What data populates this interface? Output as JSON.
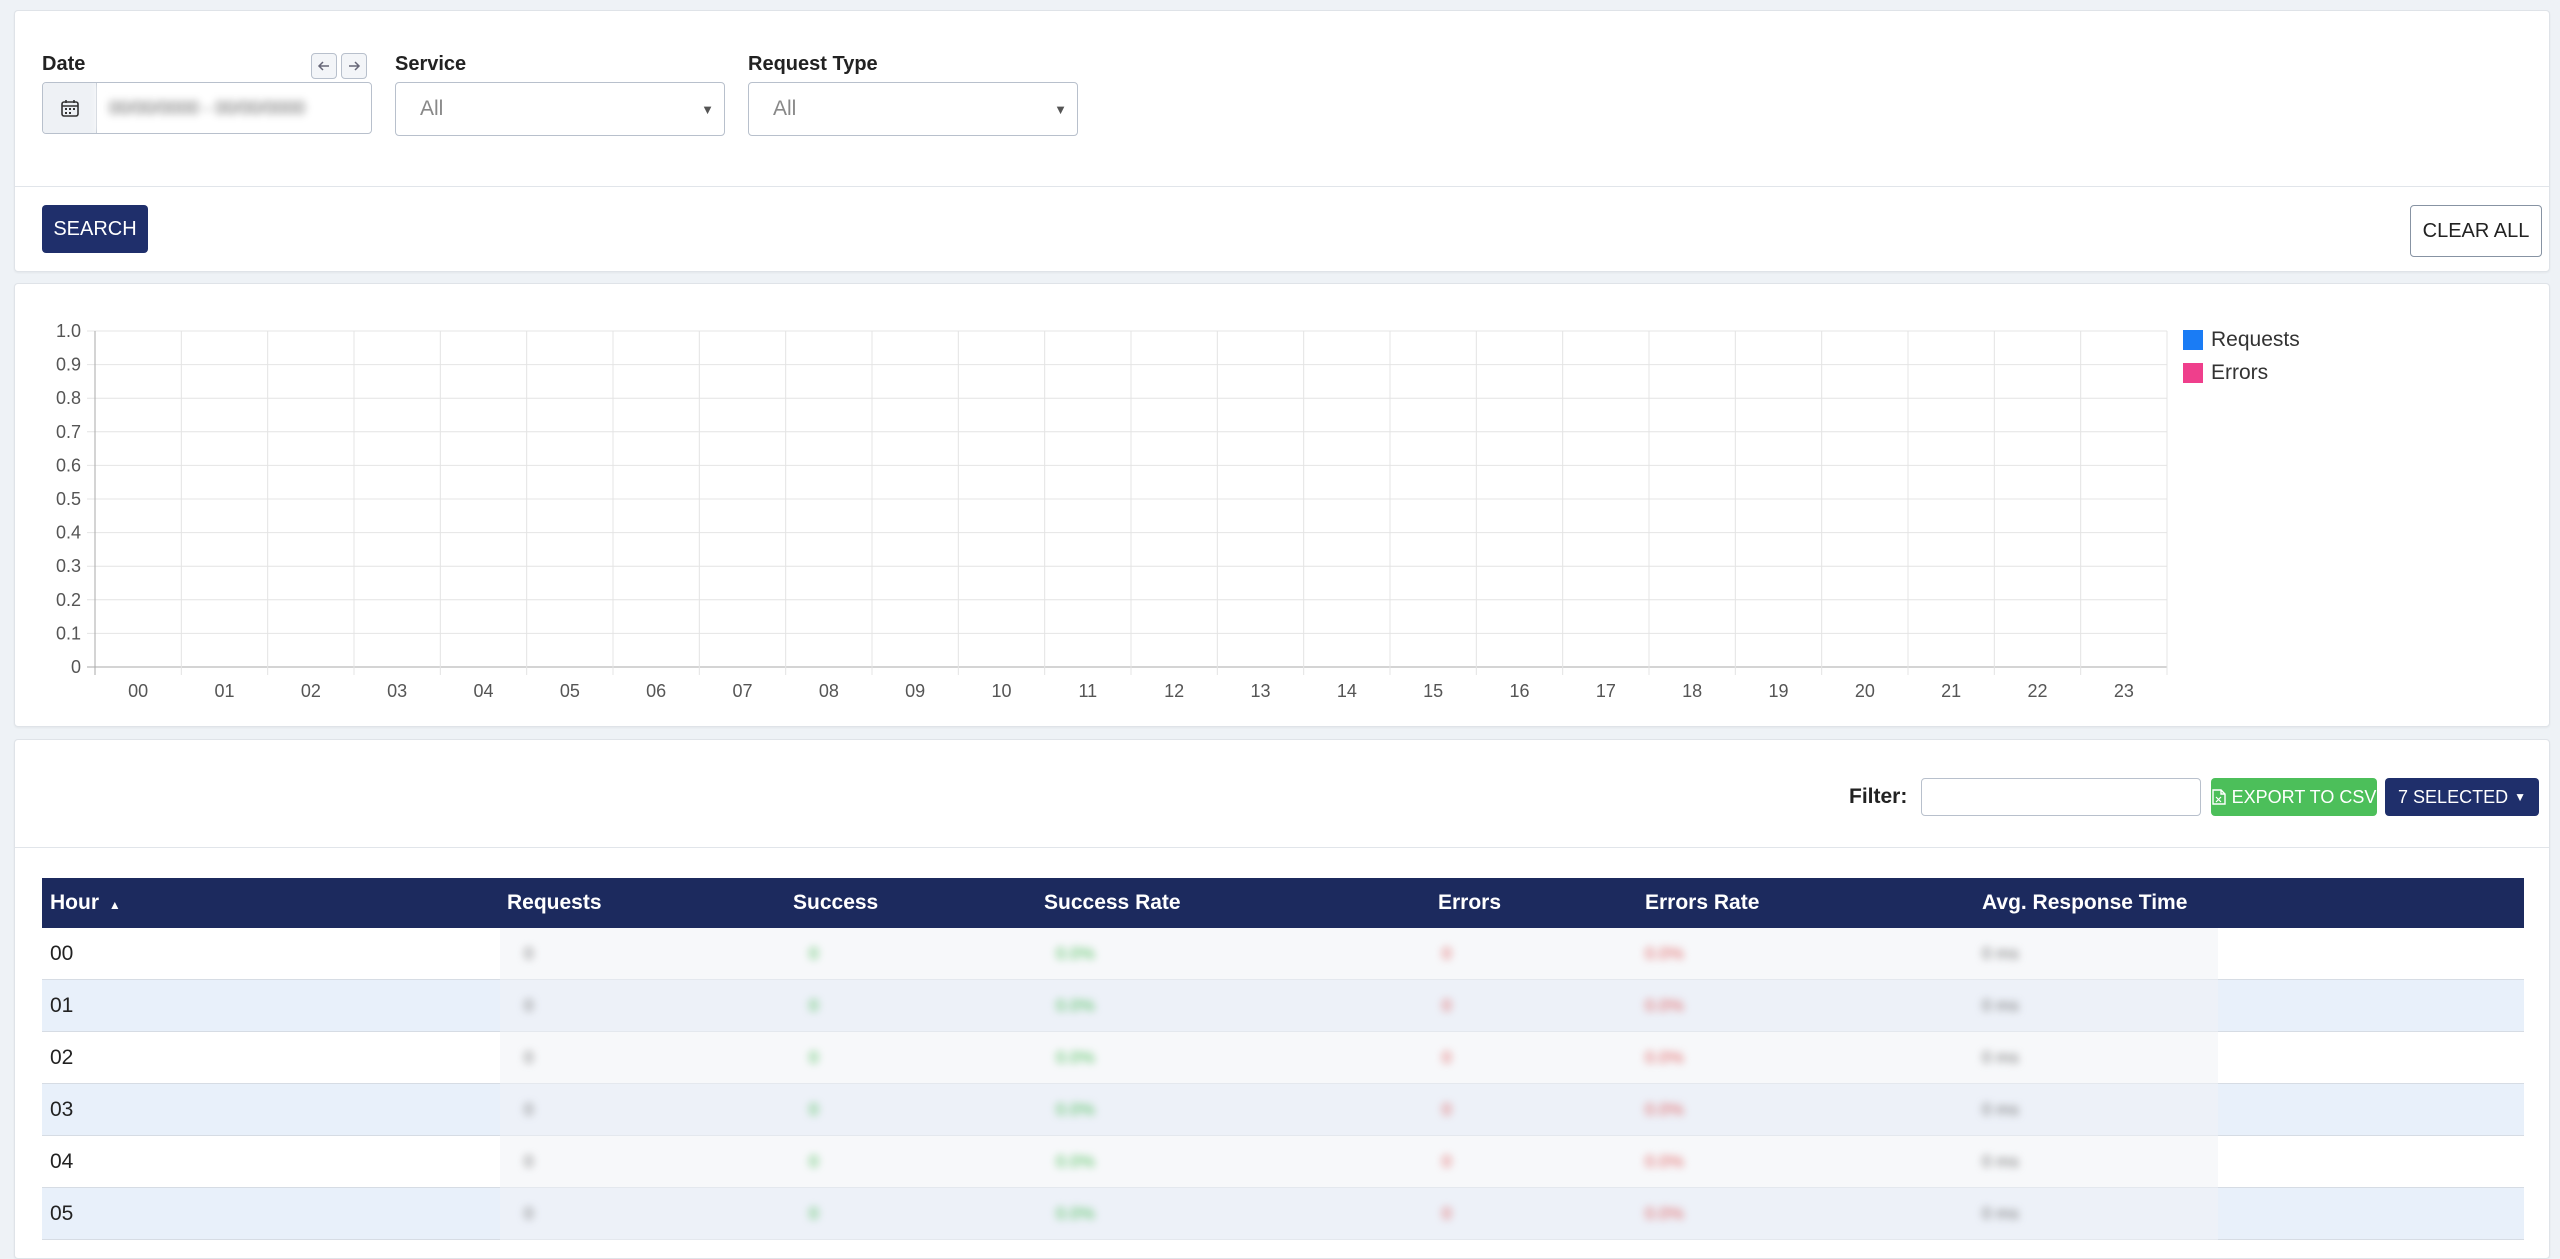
{
  "filters": {
    "date_label": "Date",
    "date_value": "00/00/0000 - 00/00/0000",
    "service_label": "Service",
    "service_value": "All",
    "request_type_label": "Request Type",
    "request_type_value": "All",
    "search_label": "SEARCH",
    "clear_label": "CLEAR ALL"
  },
  "chart_data": {
    "type": "bar",
    "categories": [
      "00",
      "01",
      "02",
      "03",
      "04",
      "05",
      "06",
      "07",
      "08",
      "09",
      "10",
      "11",
      "12",
      "13",
      "14",
      "15",
      "16",
      "17",
      "18",
      "19",
      "20",
      "21",
      "22",
      "23"
    ],
    "series": [
      {
        "name": "Requests",
        "color": "#1a7cf5",
        "values": [
          0,
          0,
          0,
          0,
          0,
          0,
          0,
          0,
          0,
          0,
          0,
          0,
          0,
          0,
          0,
          0,
          0,
          0,
          0,
          0,
          0,
          0,
          0,
          0
        ]
      },
      {
        "name": "Errors",
        "color": "#ef3f8c",
        "values": [
          0,
          0,
          0,
          0,
          0,
          0,
          0,
          0,
          0,
          0,
          0,
          0,
          0,
          0,
          0,
          0,
          0,
          0,
          0,
          0,
          0,
          0,
          0,
          0
        ]
      }
    ],
    "yticks": [
      "0",
      "0.1",
      "0.2",
      "0.3",
      "0.4",
      "0.5",
      "0.6",
      "0.7",
      "0.8",
      "0.9",
      "1.0"
    ],
    "ylim": [
      0,
      1
    ],
    "grid": true,
    "legend_position": "top-right"
  },
  "table": {
    "filter_label": "Filter:",
    "filter_value": "",
    "export_label": "EXPORT TO CSV",
    "columns_label": "7 SELECTED",
    "headers": [
      "Hour",
      "Requests",
      "Success",
      "Success Rate",
      "Errors",
      "Errors Rate",
      "Avg. Response Time"
    ],
    "sort_indicator": "▲",
    "rows": [
      {
        "hour": "00",
        "requests": "0",
        "success": "0",
        "success_rate": "0.0%",
        "errors": "0",
        "errors_rate": "0.0%",
        "avg": "0 ms"
      },
      {
        "hour": "01",
        "requests": "0",
        "success": "0",
        "success_rate": "0.0%",
        "errors": "0",
        "errors_rate": "0.0%",
        "avg": "0 ms"
      },
      {
        "hour": "02",
        "requests": "0",
        "success": "0",
        "success_rate": "0.0%",
        "errors": "0",
        "errors_rate": "0.0%",
        "avg": "0 ms"
      },
      {
        "hour": "03",
        "requests": "0",
        "success": "0",
        "success_rate": "0.0%",
        "errors": "0",
        "errors_rate": "0.0%",
        "avg": "0 ms"
      },
      {
        "hour": "04",
        "requests": "0",
        "success": "0",
        "success_rate": "0.0%",
        "errors": "0",
        "errors_rate": "0.0%",
        "avg": "0 ms"
      },
      {
        "hour": "05",
        "requests": "0",
        "success": "0",
        "success_rate": "0.0%",
        "errors": "0",
        "errors_rate": "0.0%",
        "avg": "0 ms"
      }
    ]
  }
}
